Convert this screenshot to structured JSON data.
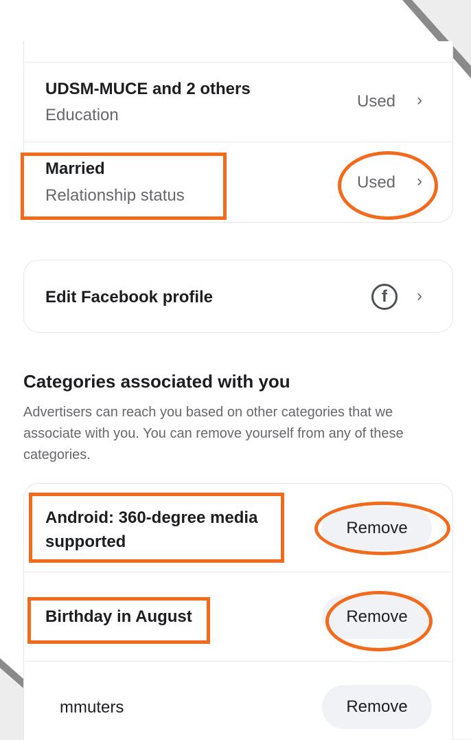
{
  "profile_info": {
    "items": [
      {
        "title": "UDSM-MUCE and 2 others",
        "subtitle": "Education",
        "status": "Used"
      },
      {
        "title": "Married",
        "subtitle": "Relationship status",
        "status": "Used"
      }
    ]
  },
  "edit_profile": {
    "label": "Edit Facebook profile",
    "icon": "facebook-icon"
  },
  "categories": {
    "heading": "Categories associated with you",
    "description": "Advertisers can reach you based on other categories that we associate with you. You can remove yourself from any of these categories.",
    "items": [
      {
        "label": "Android: 360-degree media supported",
        "button": "Remove"
      },
      {
        "label": "Birthday in August",
        "button": "Remove"
      },
      {
        "label": "mmuters",
        "button": "Remove"
      }
    ]
  },
  "chevron": "›",
  "colors": {
    "highlight": "#f26a1b",
    "button_bg": "#f0f2f5",
    "secondary_text": "#65676b"
  }
}
